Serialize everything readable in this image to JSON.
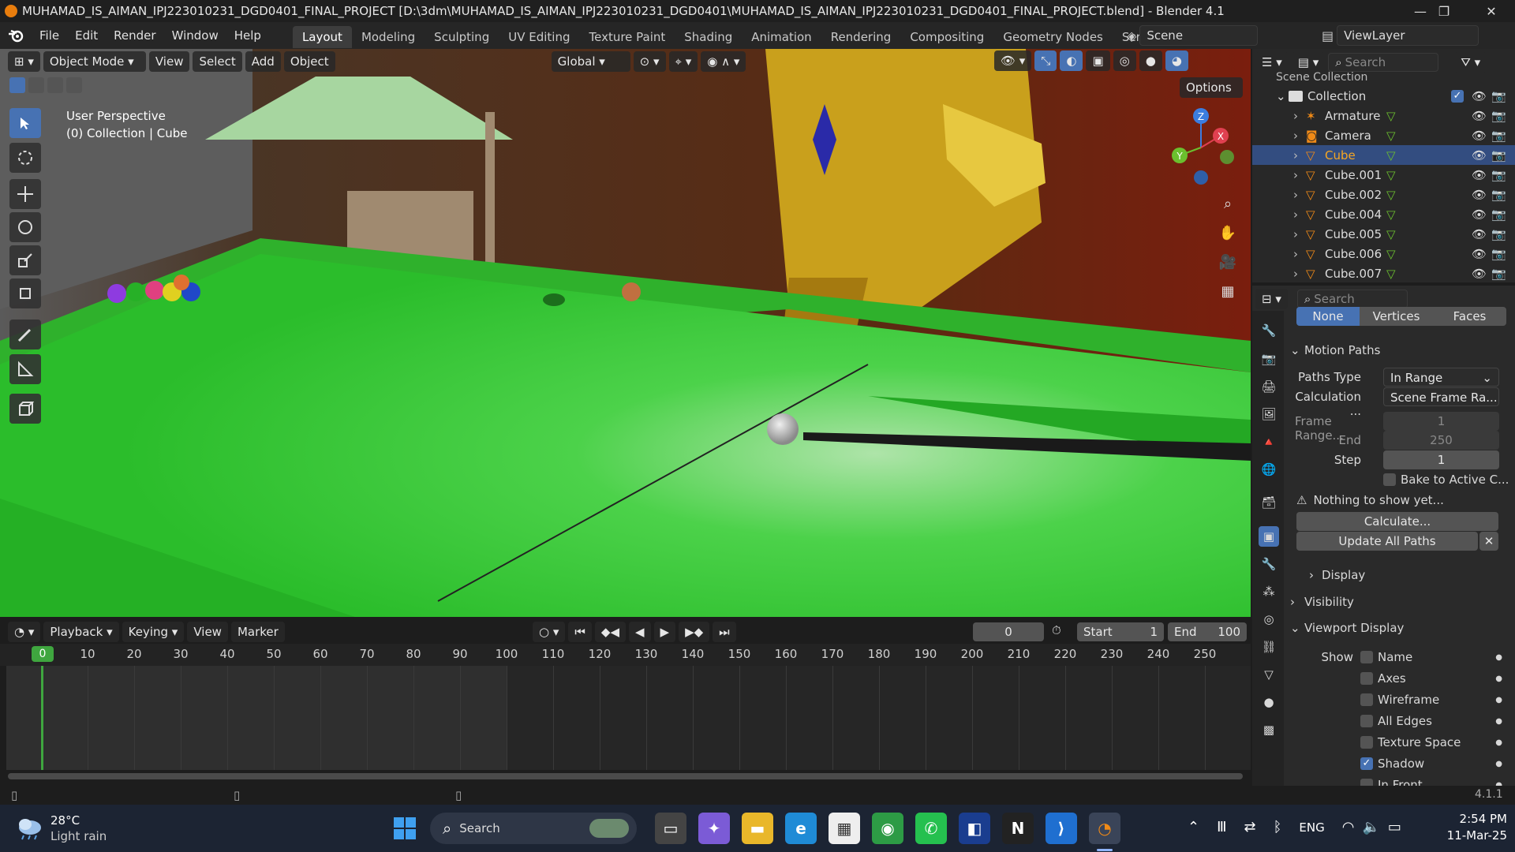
{
  "window": {
    "title": "MUHAMAD_IS_AIMAN_IPJ223010231_DGD0401_FINAL_PROJECT [D:\\3dm\\MUHAMAD_IS_AIMAN_IPJ223010231_DGD0401\\MUHAMAD_IS_AIMAN_IPJ223010231_DGD0401_FINAL_PROJECT.blend] - Blender 4.1",
    "minimize": "—",
    "maximize": "❐",
    "close": "✕"
  },
  "menu": {
    "items": [
      "File",
      "Edit",
      "Render",
      "Window",
      "Help"
    ],
    "workspaces": [
      "Layout",
      "Modeling",
      "Sculpting",
      "UV Editing",
      "Texture Paint",
      "Shading",
      "Animation",
      "Rendering",
      "Compositing",
      "Geometry Nodes",
      "Scripting"
    ],
    "add_workspace": "+",
    "scene": "Scene",
    "view_layer": "ViewLayer"
  },
  "viewport": {
    "mode": "Object Mode",
    "menus": [
      "View",
      "Select",
      "Add",
      "Object"
    ],
    "transform_orientation": "Global",
    "options": "Options",
    "overlay_line1": "User Perspective",
    "overlay_line2": "(0) Collection | Cube",
    "gizmo_axes": [
      "Z",
      "Y",
      "X"
    ]
  },
  "timeline": {
    "menus": [
      "Playback",
      "Keying",
      "View",
      "Marker"
    ],
    "current_frame": "0",
    "start_label": "Start",
    "start": "1",
    "end_label": "End",
    "end": "100",
    "ticks": [
      "0",
      "10",
      "20",
      "30",
      "40",
      "50",
      "60",
      "70",
      "80",
      "90",
      "100",
      "110",
      "120",
      "130",
      "140",
      "150",
      "160",
      "170",
      "180",
      "190",
      "200",
      "210",
      "220",
      "230",
      "240",
      "250"
    ]
  },
  "outliner": {
    "search_placeholder": "Search",
    "header": "Scene Collection",
    "collection": "Collection",
    "items": [
      {
        "name": "Armature",
        "selected": false
      },
      {
        "name": "Camera",
        "selected": false
      },
      {
        "name": "Cube",
        "selected": true
      },
      {
        "name": "Cube.001",
        "selected": false
      },
      {
        "name": "Cube.002",
        "selected": false
      },
      {
        "name": "Cube.004",
        "selected": false
      },
      {
        "name": "Cube.005",
        "selected": false
      },
      {
        "name": "Cube.006",
        "selected": false
      },
      {
        "name": "Cube.007",
        "selected": false
      }
    ]
  },
  "properties": {
    "search_placeholder": "Search",
    "seg": [
      "None",
      "Vertices",
      "Faces"
    ],
    "motion_paths": {
      "title": "Motion Paths",
      "paths_type_label": "Paths Type",
      "paths_type": "In Range",
      "calculation_label": "Calculation ...",
      "calculation": "Scene Frame Ra...",
      "frame_range_label": "Frame Range...",
      "frame_range": "1",
      "end_label": "End",
      "end": "250",
      "step_label": "Step",
      "step": "1",
      "bake_label": "Bake to Active C...",
      "nothing": "Nothing to show yet...",
      "calculate": "Calculate...",
      "update_all": "Update All Paths",
      "display": "Display"
    },
    "visibility": "Visibility",
    "viewport_display": {
      "title": "Viewport Display",
      "show_label": "Show",
      "options": [
        {
          "label": "Name",
          "checked": false
        },
        {
          "label": "Axes",
          "checked": false
        },
        {
          "label": "Wireframe",
          "checked": false
        },
        {
          "label": "All Edges",
          "checked": false
        },
        {
          "label": "Texture Space",
          "checked": false
        },
        {
          "label": "Shadow",
          "checked": true
        },
        {
          "label": "In Front",
          "checked": false
        }
      ]
    }
  },
  "status": {
    "version": "4.1.1"
  },
  "taskbar": {
    "weather_temp": "28°C",
    "weather_desc": "Light rain",
    "search": "Search",
    "lang": "ENG",
    "time": "2:54 PM",
    "date": "11-Mar-25"
  },
  "colors": {
    "accent": "#4772b3",
    "selected_row": "#334d80",
    "felt": "#22c22a",
    "playhead": "#3fa63f"
  }
}
